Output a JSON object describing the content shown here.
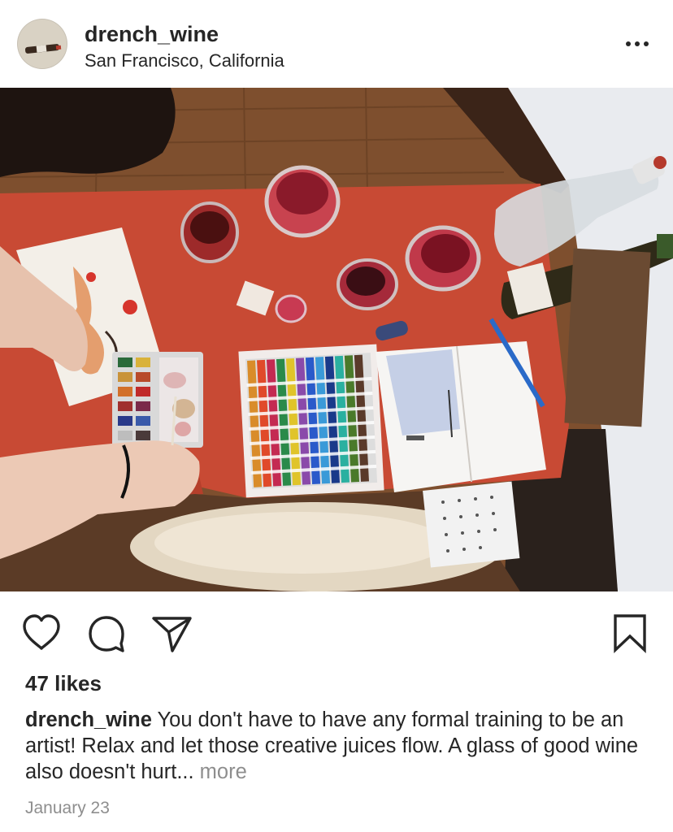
{
  "post": {
    "username": "drench_wine",
    "location": "San Francisco, California",
    "more_options_icon": "more-horizontal-icon",
    "image_alt": "Watercolor painting session on a red table with wine glasses, colored pencils and a sketchbook",
    "actions": {
      "like_icon": "heart-icon",
      "comment_icon": "comment-icon",
      "share_icon": "paper-plane-icon",
      "save_icon": "bookmark-icon"
    },
    "likes": "47 likes",
    "caption": {
      "username": "drench_wine",
      "text": "You don't have to have any formal training to be an artist! Relax and let those creative juices flow. A glass of good wine also doesn't hurt...",
      "more_label": "more"
    },
    "date": "January 23"
  },
  "colors": {
    "text": "#262626",
    "secondary_text": "#8e8e8e",
    "table_red": "#c84a34",
    "background": "#ffffff"
  }
}
